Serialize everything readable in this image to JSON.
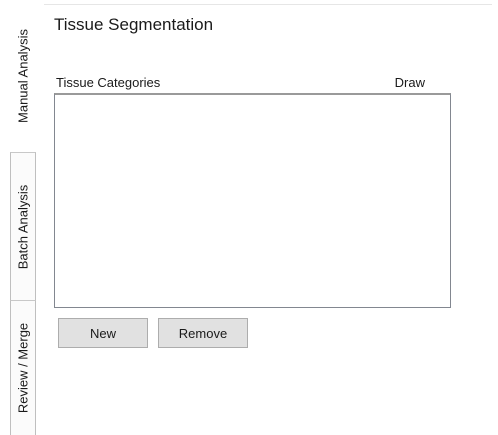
{
  "tabs": [
    {
      "label": "Manual Analysis",
      "selected": true
    },
    {
      "label": "Batch  Analysis",
      "selected": false
    },
    {
      "label": "Review / Merge",
      "selected": false
    }
  ],
  "panel": {
    "title": "Tissue Segmentation",
    "list": {
      "columns": [
        "Tissue Categories",
        "Draw"
      ],
      "rows": []
    },
    "buttons": {
      "new_label": "New",
      "remove_label": "Remove"
    }
  }
}
